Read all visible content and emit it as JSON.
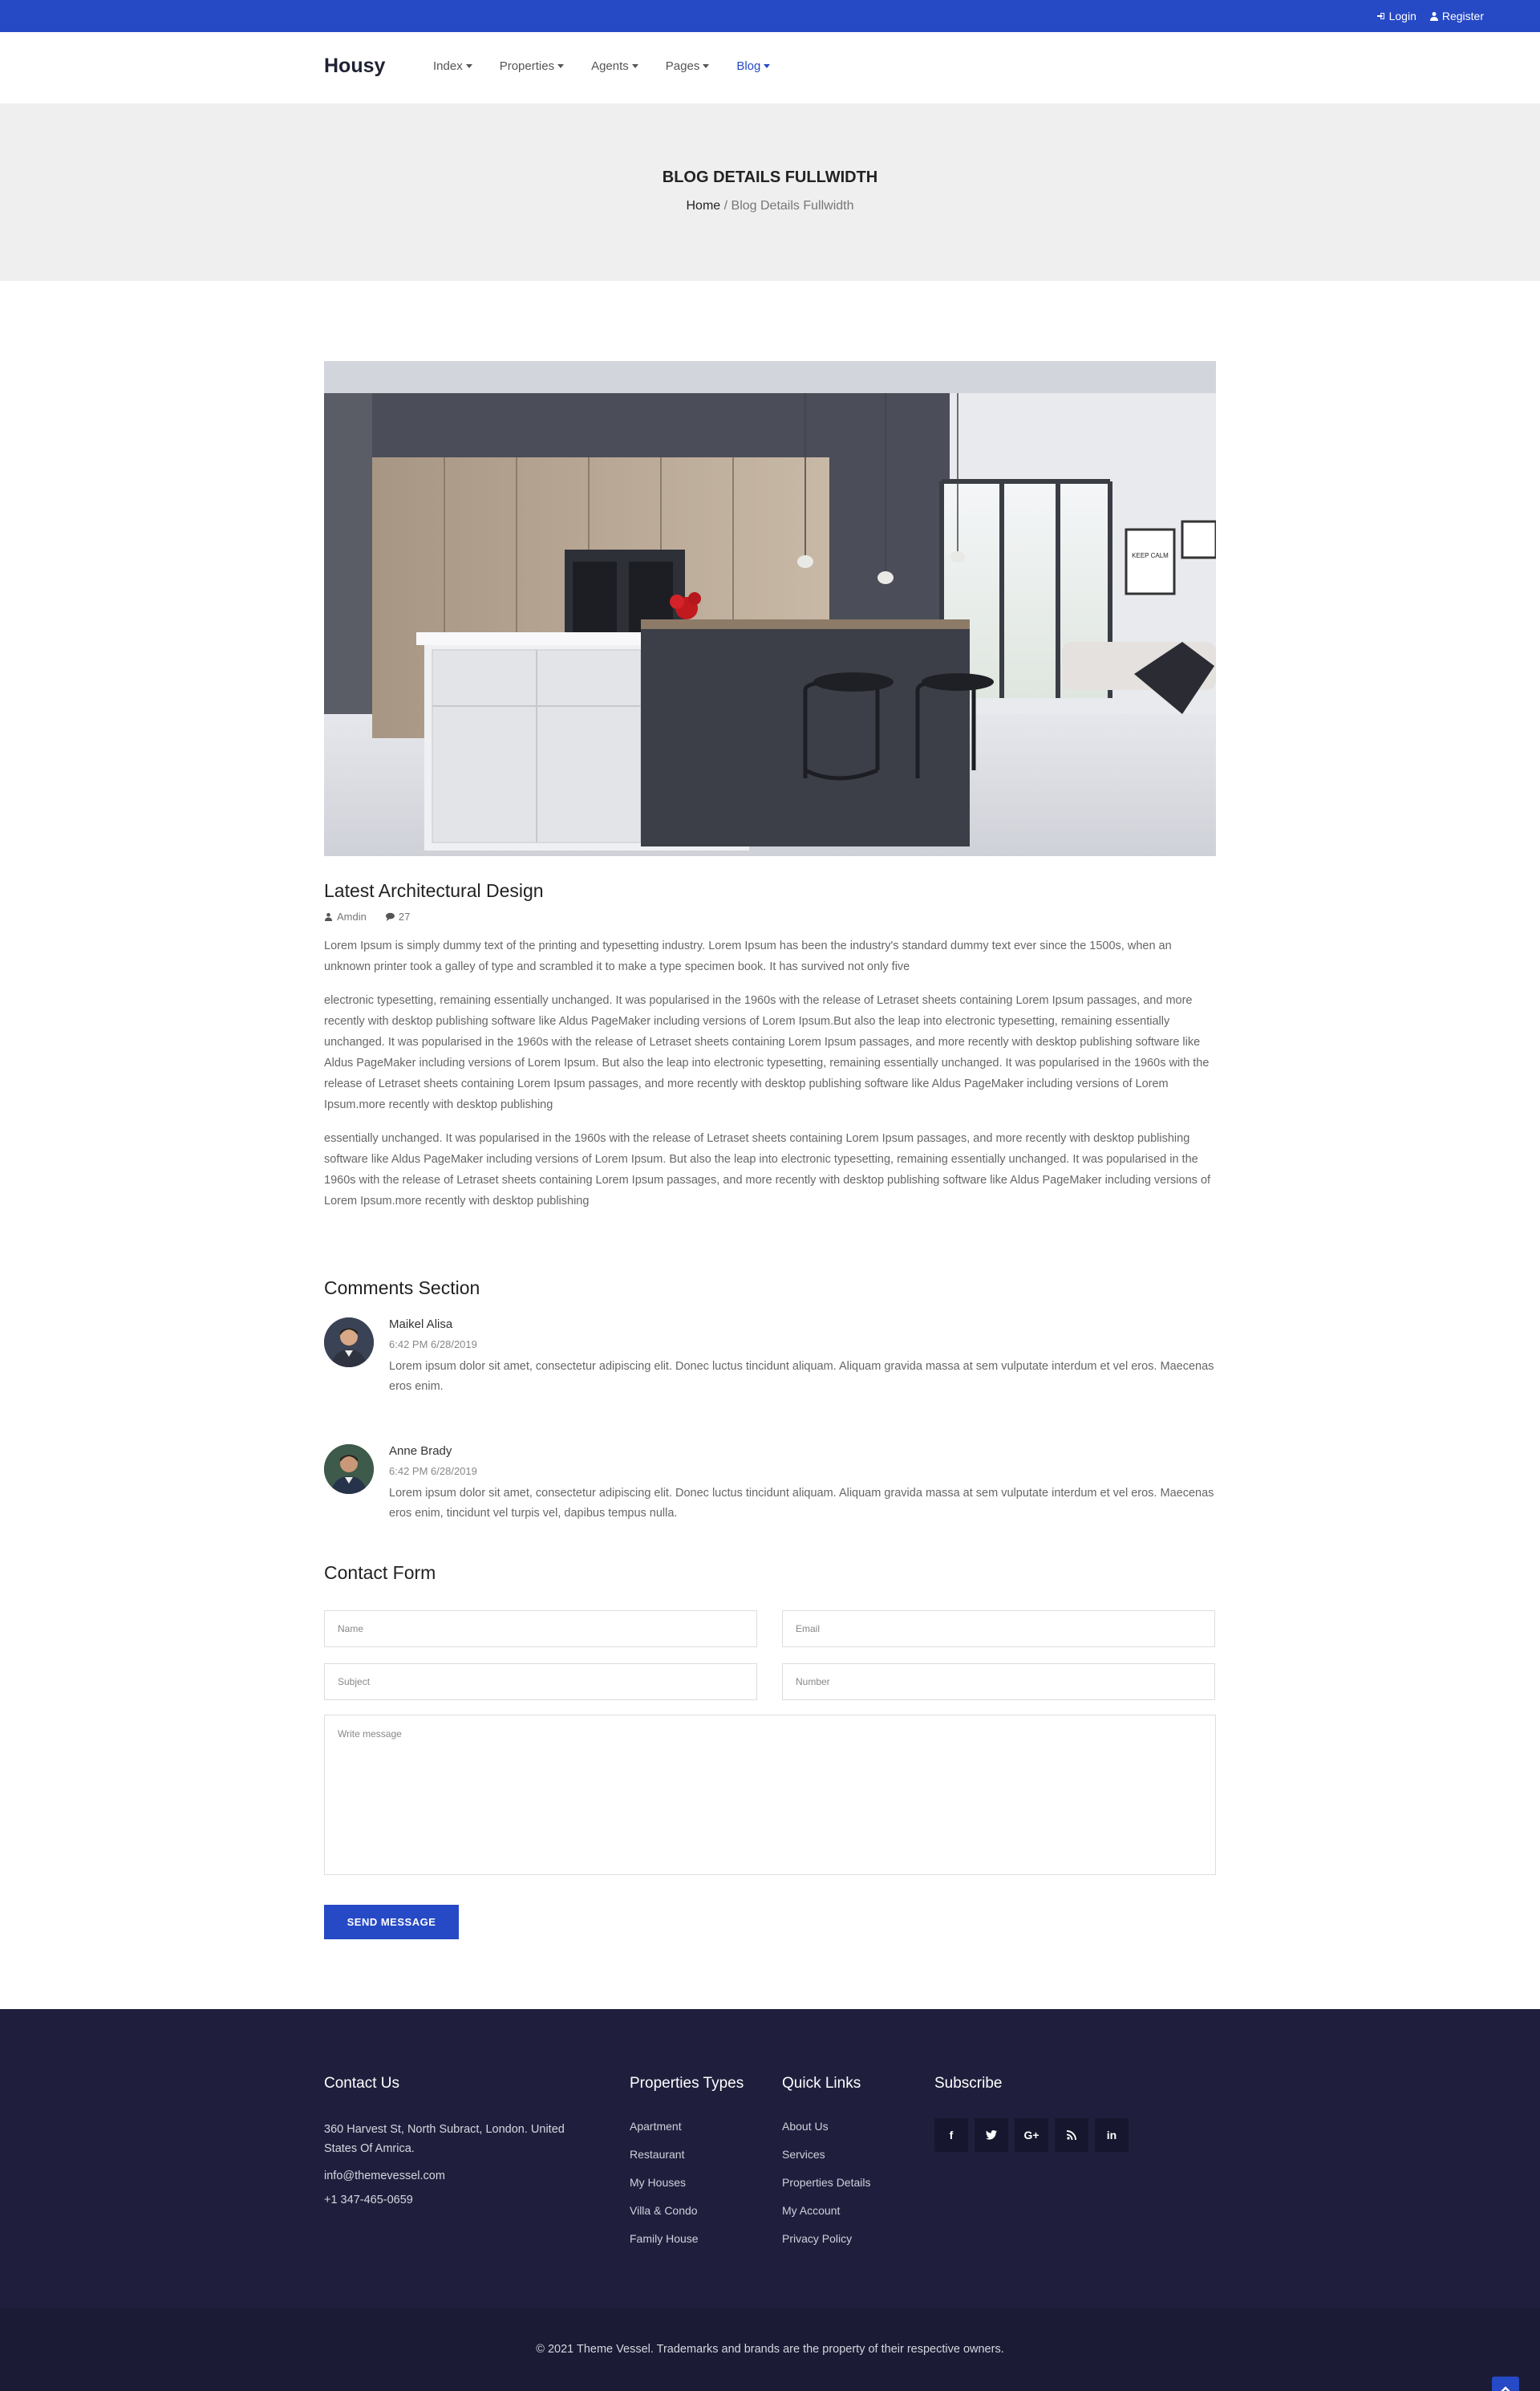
{
  "topbar": {
    "login": "Login",
    "register": "Register",
    "accent": "#2649c5"
  },
  "nav": {
    "logo": "Housy",
    "items": [
      {
        "label": "Index"
      },
      {
        "label": "Properties"
      },
      {
        "label": "Agents"
      },
      {
        "label": "Pages"
      },
      {
        "label": "Blog",
        "active": true
      }
    ]
  },
  "banner": {
    "title": "Blog Details Fullwidth",
    "crumb_home": "Home",
    "crumb_current": "/ Blog Details Fullwidth"
  },
  "post": {
    "title": "Latest Architectural Design",
    "author": "Amdin",
    "comments": "27",
    "paragraphs": [
      "Lorem Ipsum is simply dummy text of the printing and typesetting industry. Lorem Ipsum has been the industry's standard dummy text ever since the 1500s, when an unknown printer took a galley of type and scrambled it to make a type specimen book. It has survived not only five",
      "electronic typesetting, remaining essentially unchanged. It was popularised in the 1960s with the release of Letraset sheets containing Lorem Ipsum passages, and more recently with desktop publishing software like Aldus PageMaker including versions of Lorem Ipsum.But also the leap into electronic typesetting, remaining essentially unchanged. It was popularised in the 1960s with the release of Letraset sheets containing Lorem Ipsum passages, and more recently with desktop publishing software like Aldus PageMaker including versions of Lorem Ipsum. But also the leap into electronic typesetting, remaining essentially unchanged. It was popularised in the 1960s with the release of Letraset sheets containing Lorem Ipsum passages, and more recently with desktop publishing software like Aldus PageMaker including versions of Lorem Ipsum.more recently with desktop publishing",
      "essentially unchanged. It was popularised in the 1960s with the release of Letraset sheets containing Lorem Ipsum passages, and more recently with desktop publishing software like Aldus PageMaker including versions of Lorem Ipsum. But also the leap into electronic typesetting, remaining essentially unchanged. It was popularised in the 1960s with the release of Letraset sheets containing Lorem Ipsum passages, and more recently with desktop publishing software like Aldus PageMaker including versions of Lorem Ipsum.more recently with desktop publishing"
    ],
    "poster_text": "KEEP CALM AND BE YOURSELF"
  },
  "comments": {
    "heading": "Comments Section",
    "items": [
      {
        "name": "Maikel Alisa",
        "time": "6:42 PM 6/28/2019",
        "text": "Lorem ipsum dolor sit amet, consectetur adipiscing elit. Donec luctus tincidunt aliquam. Aliquam gravida massa at sem vulputate interdum et vel eros. Maecenas eros enim."
      },
      {
        "name": "Anne Brady",
        "time": "6:42 PM 6/28/2019",
        "text": "Lorem ipsum dolor sit amet, consectetur adipiscing elit. Donec luctus tincidunt aliquam. Aliquam gravida massa at sem vulputate interdum et vel eros. Maecenas eros enim, tincidunt vel turpis vel, dapibus tempus nulla."
      }
    ]
  },
  "form": {
    "heading": "Contact Form",
    "name_ph": "Name",
    "email_ph": "Email",
    "subject_ph": "Subject",
    "number_ph": "Number",
    "message_ph": "Write message",
    "submit": "SEND MESSAGE"
  },
  "footer": {
    "contact": {
      "heading": "Contact Us",
      "address": "360 Harvest St, North Subract, London. United States Of Amrica.",
      "email": "info@themevessel.com",
      "phone": "+1 347-465-0659"
    },
    "types": {
      "heading": "Properties Types",
      "items": [
        "Apartment",
        "Restaurant",
        "My Houses",
        "Villa & Condo",
        "Family House"
      ]
    },
    "links": {
      "heading": "Quick Links",
      "items": [
        "About Us",
        "Services",
        "Properties Details",
        "My Account",
        "Privacy Policy"
      ]
    },
    "subscribe": {
      "heading": "Subscribe",
      "social": [
        "f",
        "t",
        "G+",
        "rss",
        "in"
      ]
    },
    "copyright": "© 2021 Theme Vessel. Trademarks and brands are the property of their respective owners."
  }
}
